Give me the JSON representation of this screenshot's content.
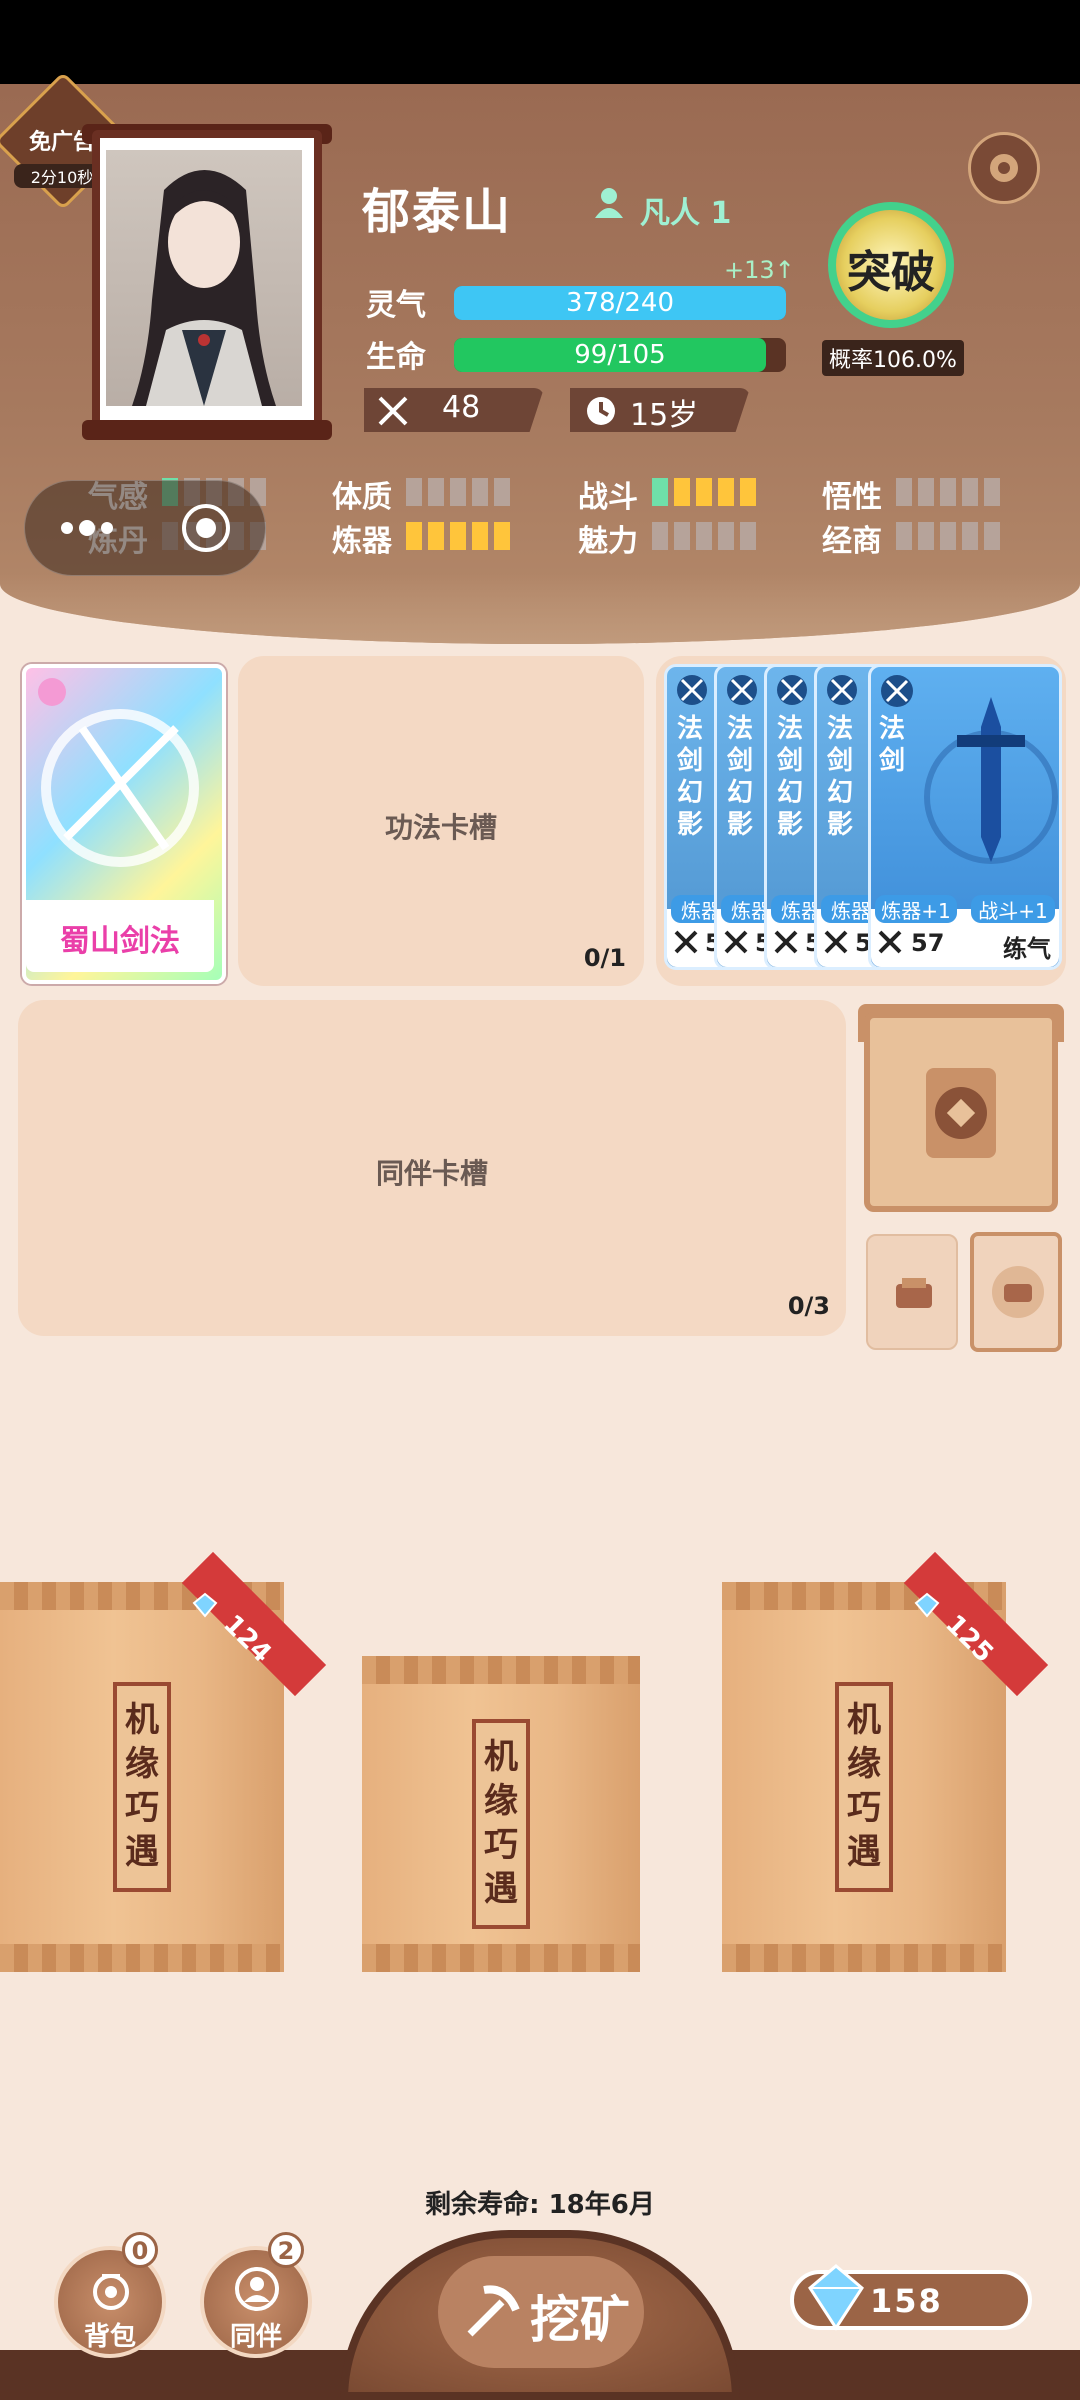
{
  "ad_badge": {
    "label": "免广告",
    "timer": "2分10秒"
  },
  "player": {
    "name": "郁泰山",
    "rank": "凡人 1",
    "spirit_label": "灵气",
    "spirit_value": "378/240",
    "spirit_gain": "+13↑",
    "life_label": "生命",
    "life_value": "99/105",
    "power": "48",
    "age": "15岁"
  },
  "breakthrough": {
    "label": "突破",
    "probability": "概率106.0%"
  },
  "attributes": [
    {
      "name": "气感",
      "level": 1,
      "color": "green"
    },
    {
      "name": "炼丹",
      "level": 0,
      "color": "yellow"
    },
    {
      "name": "体质",
      "level": 0,
      "color": "yellow"
    },
    {
      "name": "炼器",
      "level": 5,
      "color": "yellow"
    },
    {
      "name": "战斗",
      "level": 5,
      "color": "mixed"
    },
    {
      "name": "魅力",
      "level": 0,
      "color": "yellow"
    },
    {
      "name": "悟性",
      "level": 0,
      "color": "yellow"
    },
    {
      "name": "经商",
      "level": 0,
      "color": "yellow"
    }
  ],
  "skill_card": {
    "name": "蜀山剑法"
  },
  "skill_slot": {
    "label": "功法卡槽",
    "count": "0/1"
  },
  "artifact_stack": {
    "back_card_name": "法剑幻影",
    "back_tag": "炼器",
    "back_power": "5",
    "main_name": "法剑",
    "main_tag1": "炼器+1",
    "main_tag2": "战斗+1",
    "main_power": "57",
    "main_type": "练气"
  },
  "companion_slot": {
    "label": "同伴卡槽",
    "count": "0/3"
  },
  "packs": [
    {
      "label": "机缘巧遇",
      "price": "124"
    },
    {
      "label": "机缘巧遇",
      "price": ""
    },
    {
      "label": "机缘巧遇",
      "price": "125"
    }
  ],
  "remaining_life": "剩余寿命: 18年6月",
  "bottom": {
    "bag_label": "背包",
    "bag_count": "0",
    "companion_label": "同伴",
    "companion_count": "2",
    "mine_label": "挖矿",
    "gems": "158"
  },
  "colors": {
    "spirit_bar": "#3ec6f4",
    "life_bar": "#22c760",
    "accent_yellow": "#ffc53b",
    "accent_green": "#6fe0a9"
  }
}
